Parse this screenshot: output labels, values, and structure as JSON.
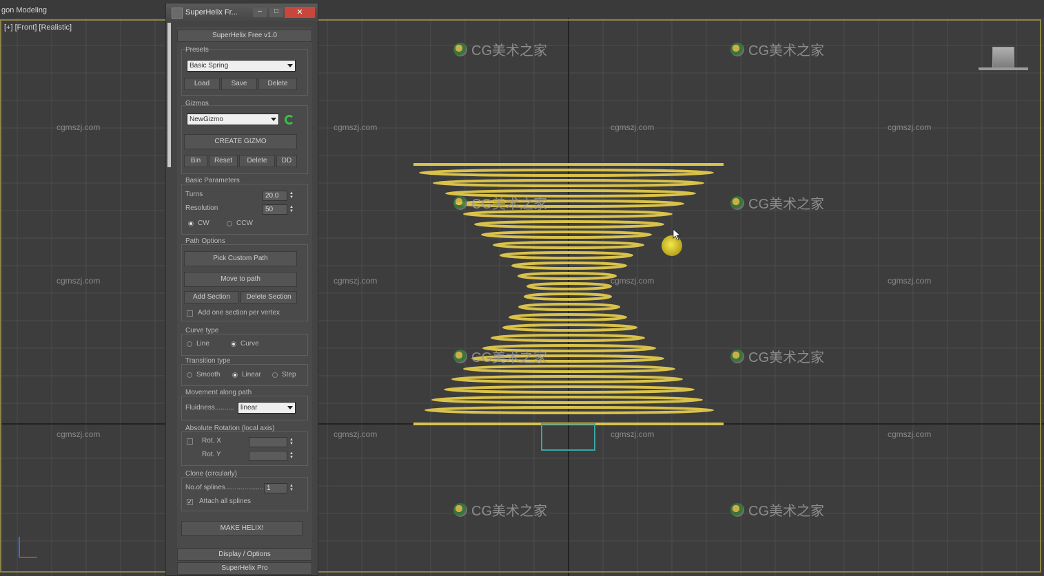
{
  "app": {
    "mode_tab": "gon Modeling",
    "viewport_label": "[+] [Front] [Realistic]"
  },
  "panel": {
    "title": "SuperHelix Fr...",
    "rollout_title": "SuperHelix Free v1.0",
    "presets": {
      "label": "Presets",
      "selected": "Basic Spring",
      "buttons": [
        "Load",
        "Save",
        "Delete"
      ]
    },
    "gizmos": {
      "label": "Gizmos",
      "selected": "NewGizmo",
      "create_label": "CREATE GIZMO",
      "buttons": [
        "Bin",
        "Reset",
        "Delete",
        "DD"
      ]
    },
    "basic": {
      "label": "Basic Parameters",
      "turns_label": "Turns",
      "turns_value": "20.0",
      "resolution_label": "Resolution",
      "resolution_value": "50",
      "cw": "CW",
      "ccw": "CCW"
    },
    "path": {
      "label": "Path Options",
      "pick_label": "Pick Custom Path",
      "move_label": "Move to path",
      "add_label": "Add Section",
      "delete_label": "Delete Section",
      "one_section_label": "Add one section per vertex"
    },
    "curve": {
      "label": "Curve type",
      "line": "Line",
      "curve": "Curve"
    },
    "transition": {
      "label": "Transition type",
      "smooth": "Smooth",
      "linear": "Linear",
      "step": "Step"
    },
    "movement": {
      "label": "Movement along path",
      "fluidness_label": "Fluidness..........",
      "fluidness_value": "linear"
    },
    "rotation": {
      "label": "Absolute Rotation (local axis)",
      "rot_x": "Rot. X",
      "rot_y": "Rot. Y"
    },
    "clone": {
      "label": "Clone (circularly)",
      "splines_label": "No.of splines........................",
      "splines_value": "1",
      "attach_label": "Attach all splines"
    },
    "make_label": "MAKE HELIX!",
    "display_label": "Display / Options",
    "pro_label": "SuperHelix Pro"
  },
  "watermark": {
    "site": "cgmszj.com",
    "brand": "CG美术之家"
  },
  "colors": {
    "helix": "#d9c24a",
    "viewport_bg": "#3d3d3d",
    "active_border": "#8b8347",
    "grid": "#4f4f4f",
    "panel_bg": "#444444"
  }
}
